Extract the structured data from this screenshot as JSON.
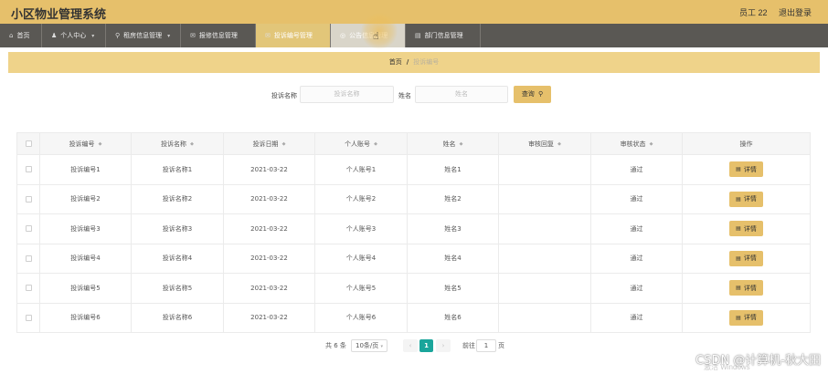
{
  "app": {
    "title": "小区物业管理系统"
  },
  "topbar": {
    "user": "员工 22",
    "logout": "退出登录"
  },
  "nav": [
    {
      "label": "首页",
      "icon": "home-icon",
      "glyph": "⌂",
      "caret": false
    },
    {
      "label": "个人中心",
      "icon": "user-icon",
      "glyph": "♟",
      "caret": true
    },
    {
      "label": "租房信息管理",
      "icon": "location-icon",
      "glyph": "⚲",
      "caret": true
    },
    {
      "label": "报修信息管理",
      "icon": "message-icon",
      "glyph": "✉",
      "caret": false
    },
    {
      "label": "投诉编号管理",
      "icon": "message-icon",
      "glyph": "✉",
      "caret": false,
      "active": true
    },
    {
      "label": "公告信息管理",
      "icon": "notice-icon",
      "glyph": "◎",
      "caret": false,
      "hover": true
    },
    {
      "label": "部门信息管理",
      "icon": "folder-icon",
      "glyph": "▤",
      "caret": false
    }
  ],
  "breadcrumb": {
    "home": "首页",
    "separator": "/",
    "current": "投诉编号"
  },
  "search": {
    "name_label": "投诉名称",
    "name_placeholder": "投诉名称",
    "person_label": "姓名",
    "person_placeholder": "姓名",
    "button_label": "查询",
    "button_icon": "search-icon"
  },
  "table": {
    "columns": [
      "投诉编号",
      "投诉名称",
      "投诉日期",
      "个人账号",
      "姓名",
      "审核回复",
      "审核状态",
      "操作"
    ],
    "sortable": [
      true,
      true,
      true,
      true,
      true,
      true,
      true,
      false
    ],
    "rows": [
      {
        "id": "投诉编号1",
        "name": "投诉名称1",
        "date": "2021-03-22",
        "account": "个人账号1",
        "person": "姓名1",
        "reply": "",
        "status": "通过",
        "action": "详情"
      },
      {
        "id": "投诉编号2",
        "name": "投诉名称2",
        "date": "2021-03-22",
        "account": "个人账号2",
        "person": "姓名2",
        "reply": "",
        "status": "通过",
        "action": "详情"
      },
      {
        "id": "投诉编号3",
        "name": "投诉名称3",
        "date": "2021-03-22",
        "account": "个人账号3",
        "person": "姓名3",
        "reply": "",
        "status": "通过",
        "action": "详情"
      },
      {
        "id": "投诉编号4",
        "name": "投诉名称4",
        "date": "2021-03-22",
        "account": "个人账号4",
        "person": "姓名4",
        "reply": "",
        "status": "通过",
        "action": "详情"
      },
      {
        "id": "投诉编号5",
        "name": "投诉名称5",
        "date": "2021-03-22",
        "account": "个人账号5",
        "person": "姓名5",
        "reply": "",
        "status": "通过",
        "action": "详情"
      },
      {
        "id": "投诉编号6",
        "name": "投诉名称6",
        "date": "2021-03-22",
        "account": "个人账号6",
        "person": "姓名6",
        "reply": "",
        "status": "通过",
        "action": "详情"
      }
    ]
  },
  "pagination": {
    "total": "共 6 条",
    "page_size": "10条/页",
    "current_page": "1",
    "jump_label": "前往",
    "jump_value": "1",
    "page_suffix": "页"
  },
  "watermark": {
    "text": "CSDN @计算机-秋大田",
    "faint": "激活 Windows"
  },
  "colors": {
    "accent": "#e6c06b",
    "nav_bg": "#5a5854",
    "page_active": "#1aa59b"
  }
}
